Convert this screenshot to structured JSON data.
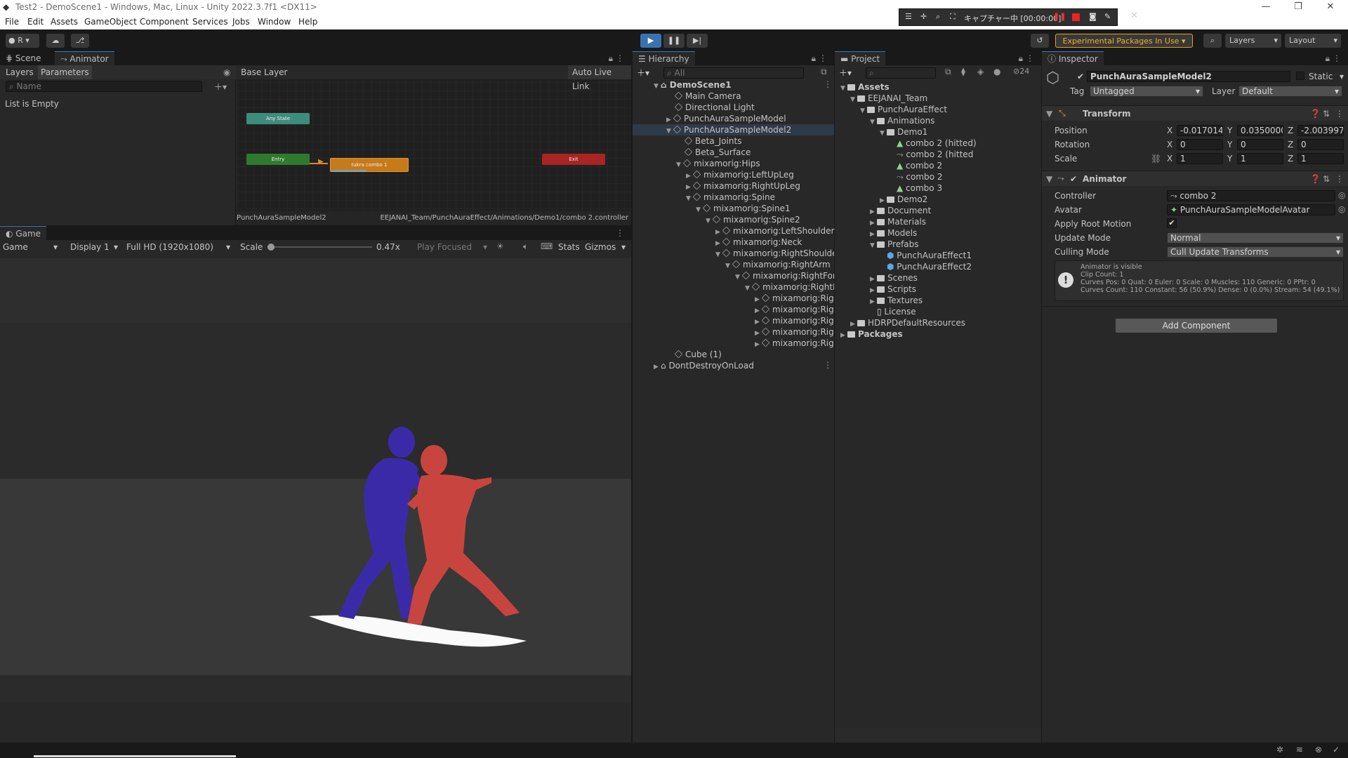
{
  "window": {
    "title": "Test2 - DemoScene1 - Windows, Mac, Linux - Unity 2022.3.7f1 <DX11>"
  },
  "menu": [
    "File",
    "Edit",
    "Assets",
    "GameObject",
    "Component",
    "Services",
    "Jobs",
    "Window",
    "Help"
  ],
  "capture_bar": {
    "text": "キャプチャー中 [00:00:00]"
  },
  "toolbar": {
    "account": "R",
    "experimental": "Experimental Packages In Use ▾",
    "layers": "Layers",
    "layout": "Layout"
  },
  "animator": {
    "tabs": [
      "Scene",
      "Animator"
    ],
    "sub_tabs": [
      "Layers",
      "Parameters"
    ],
    "name_placeholder": "Name",
    "list_empty": "List is Empty",
    "base_layer": "Base Layer",
    "auto_live_link": "Auto Live Link",
    "nodes": {
      "any_state": "Any State",
      "entry": "Entry",
      "state": "tukra combo 1",
      "exit": "Exit"
    },
    "footer_left": "PunchAuraSampleModel2",
    "footer_right": "EEJANAI_Team/PunchAuraEffect/Animations/Demo1/combo 2.controller"
  },
  "game": {
    "tab": "Game",
    "mode": "Game",
    "display": "Display 1",
    "resolution": "Full HD (1920x1080)",
    "scale_label": "Scale",
    "scale_value": "0.47x",
    "play_focused": "Play Focused",
    "stats": "Stats",
    "gizmos": "Gizmos"
  },
  "hierarchy": {
    "tab": "Hierarchy",
    "search_placeholder": "All",
    "items": [
      "DemoScene1",
      "Main Camera",
      "Directional Light",
      "PunchAuraSampleModel",
      "PunchAuraSampleModel2",
      "Beta_Joints",
      "Beta_Surface",
      "mixamorig:Hips",
      "mixamorig:LeftUpLeg",
      "mixamorig:RightUpLeg",
      "mixamorig:Spine",
      "mixamorig:Spine1",
      "mixamorig:Spine2",
      "mixamorig:LeftShoulder",
      "mixamorig:Neck",
      "mixamorig:RightShoulder",
      "mixamorig:RightArm",
      "mixamorig:RightFor",
      "mixamorig:RightH",
      "mixamorig:Rigl",
      "mixamorig:Rigl",
      "mixamorig:Rigl",
      "mixamorig:Rigl",
      "mixamorig:Rigl",
      "Cube (1)",
      "DontDestroyOnLoad"
    ]
  },
  "project": {
    "tab": "Project",
    "hidden_count": "24",
    "items": [
      "Assets",
      "EEJANAI_Team",
      "PunchAuraEffect",
      "Animations",
      "Demo1",
      "combo 2 (hitted)",
      "combo 2 (hitted",
      "combo 2",
      "combo 2",
      "combo 3",
      "Demo2",
      "Document",
      "Materials",
      "Models",
      "Prefabs",
      "PunchAuraEffect1",
      "PunchAuraEffect2",
      "Scenes",
      "Scripts",
      "Textures",
      "License",
      "HDRPDefaultResources",
      "Packages"
    ]
  },
  "inspector": {
    "tab": "Inspector",
    "object_name": "PunchAuraSampleModel2",
    "static": "Static",
    "tag_label": "Tag",
    "tag_value": "Untagged",
    "layer_label": "Layer",
    "layer_value": "Default",
    "transform": {
      "title": "Transform",
      "position_label": "Position",
      "rotation_label": "Rotation",
      "scale_label": "Scale",
      "position": [
        "-0.017014:",
        "0.0350000",
        "-2.003997"
      ],
      "rotation": [
        "0",
        "0",
        "0"
      ],
      "scale": [
        "1",
        "1",
        "1"
      ],
      "axes": [
        "X",
        "Y",
        "Z"
      ]
    },
    "animator": {
      "title": "Animator",
      "controller_label": "Controller",
      "controller_value": "combo 2",
      "avatar_label": "Avatar",
      "avatar_value": "PunchAuraSampleModelAvatar",
      "root_motion_label": "Apply Root Motion",
      "update_mode_label": "Update Mode",
      "update_mode_value": "Normal",
      "culling_label": "Culling Mode",
      "culling_value": "Cull Update Transforms",
      "info": [
        "Animator is visible",
        "Clip Count: 1",
        "Curves Pos: 0 Quat: 0 Euler: 0 Scale: 0 Muscles: 110 Generic: 0 PPtr: 0",
        "Curves Count: 110 Constant: 56 (50.9%) Dense: 0 (0.0%) Stream: 54 (49.1%)"
      ]
    },
    "add_component": "Add Component"
  },
  "colors": {
    "accent": "#3a79bb",
    "play": "#3a72b0",
    "any_state": "#3e8d7c",
    "entry": "#2f7a2f",
    "state": "#c77a1a",
    "exit": "#a92424",
    "blue_char": "#3b2aa8",
    "red_char": "#c8453f"
  }
}
